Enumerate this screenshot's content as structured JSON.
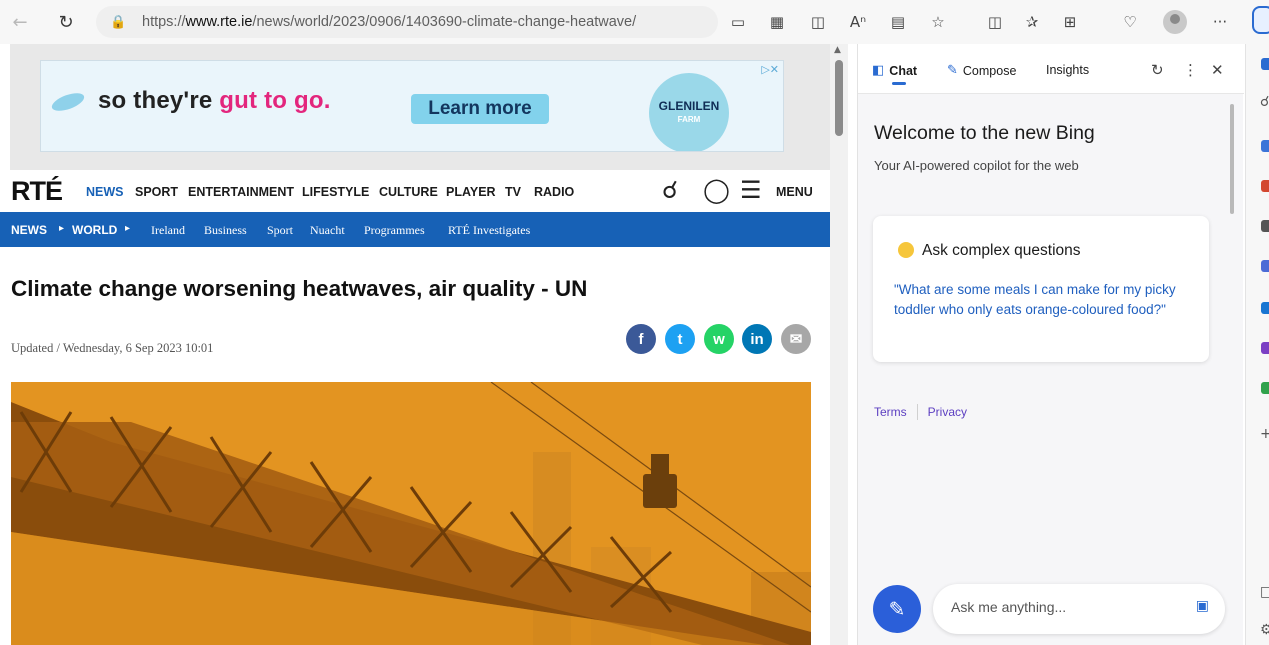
{
  "browser": {
    "url_prefix": "https://",
    "url_domain": "www.rte.ie",
    "url_path": "/news/world/2023/0906/1403690-climate-change-heatwave/",
    "more_label": "···"
  },
  "ad": {
    "slogan_a": "so they're ",
    "slogan_b": "gut to go.",
    "cta": "Learn more",
    "brand": "GLENILEN",
    "brand_sub": "FARM",
    "choices": "▷✕"
  },
  "site": {
    "logo": "RTÉ",
    "nav": [
      "NEWS",
      "SPORT",
      "ENTERTAINMENT",
      "LIFESTYLE",
      "CULTURE",
      "PLAYER",
      "TV",
      "RADIO"
    ],
    "menu_label": "MENU",
    "breadcrumb": [
      "NEWS",
      "WORLD"
    ],
    "subnav": [
      "Ireland",
      "Business",
      "Sport",
      "Nuacht",
      "Programmes",
      "RTÉ Investigates"
    ]
  },
  "article": {
    "headline": "Climate change worsening heatwaves, air quality - UN",
    "updated": "Updated / Wednesday, 6 Sep 2023 10:01",
    "share": [
      "f",
      "t",
      "w",
      "in",
      "✉"
    ]
  },
  "bing": {
    "tabs": [
      "Chat",
      "Compose",
      "Insights"
    ],
    "welcome": "Welcome to the new Bing",
    "tagline": "Your AI-powered copilot for the web",
    "card_title": "Ask complex questions",
    "card_question": "\"What are some meals I can make for my picky toddler who only eats orange-coloured food?\"",
    "terms": "Terms",
    "privacy": "Privacy",
    "ask_placeholder": "Ask me anything..."
  },
  "colors": {
    "rte_blue": "#1761b6",
    "bing_blue": "#2b5fd9",
    "facebook": "#3b5998",
    "twitter": "#1da1f2",
    "whatsapp": "#25d366",
    "linkedin": "#0077b5",
    "email": "#a7a7a7"
  }
}
